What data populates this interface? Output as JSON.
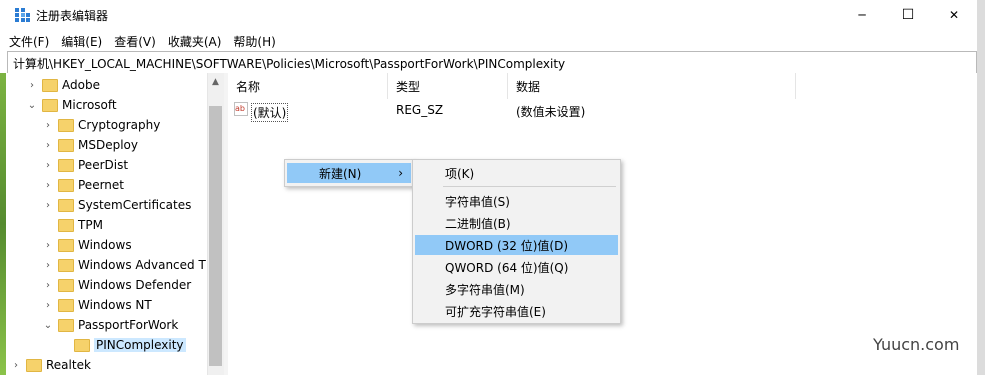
{
  "window": {
    "title": "注册表编辑器",
    "controls": {
      "minimize": "─",
      "maximize": "☐",
      "close": "✕"
    }
  },
  "menubar": [
    {
      "label": "文件(F)"
    },
    {
      "label": "编辑(E)"
    },
    {
      "label": "查看(V)"
    },
    {
      "label": "收藏夹(A)"
    },
    {
      "label": "帮助(H)"
    }
  ],
  "address": "计算机\\HKEY_LOCAL_MACHINE\\SOFTWARE\\Policies\\Microsoft\\PassportForWork\\PINComplexity",
  "tree": {
    "nodes": [
      {
        "label": "Adobe",
        "expander": "›"
      },
      {
        "label": "Microsoft",
        "expander": "⌄"
      },
      {
        "label": "Cryptography",
        "expander": "›"
      },
      {
        "label": "MSDeploy",
        "expander": "›"
      },
      {
        "label": "PeerDist",
        "expander": "›"
      },
      {
        "label": "Peernet",
        "expander": "›"
      },
      {
        "label": "SystemCertificates",
        "expander": "›"
      },
      {
        "label": "TPM",
        "expander": ""
      },
      {
        "label": "Windows",
        "expander": "›"
      },
      {
        "label": "Windows Advanced T",
        "expander": "›"
      },
      {
        "label": "Windows Defender",
        "expander": "›"
      },
      {
        "label": "Windows NT",
        "expander": "›"
      },
      {
        "label": "PassportForWork",
        "expander": "⌄"
      },
      {
        "label": "PINComplexity",
        "expander": "",
        "selected": true
      },
      {
        "label": "Realtek",
        "expander": "›"
      }
    ]
  },
  "list": {
    "columns": [
      "名称",
      "类型",
      "数据"
    ],
    "rows": [
      {
        "icon": "ab",
        "name": "(默认)",
        "type": "REG_SZ",
        "data": "(数值未设置)"
      }
    ]
  },
  "context_menu": {
    "new_label": "新建(N)",
    "arrow": "›",
    "submenu": [
      {
        "label": "项(K)"
      },
      {
        "label": "字符串值(S)"
      },
      {
        "label": "二进制值(B)"
      },
      {
        "label": "DWORD (32 位)值(D)",
        "highlighted": true
      },
      {
        "label": "QWORD (64 位)值(Q)"
      },
      {
        "label": "多字符串值(M)"
      },
      {
        "label": "可扩充字符串值(E)"
      }
    ]
  },
  "watermark": "Yuucn.com",
  "colors": {
    "selection": "#91c9f7",
    "tree_selection": "#cce8ff",
    "folder": "#f6d26b"
  }
}
